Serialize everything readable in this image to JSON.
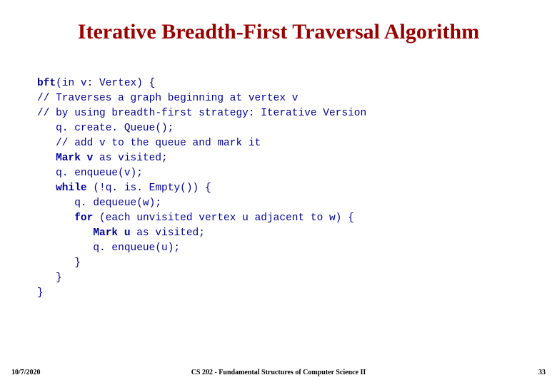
{
  "title": "Iterative Breadth-First Traversal Algorithm",
  "code": {
    "l1a": "bft",
    "l1b": "(in v: Vertex) {",
    "l2": "// Traverses a graph beginning at vertex v",
    "l3": "// by using breadth-first strategy: Iterative Version",
    "l4": "   q. create. Queue();",
    "l5": "   // add v to the queue and mark it",
    "l6a": "   Mark v",
    "l6b": " as visited;",
    "l7": "   q. enqueue(v);",
    "l8a": "   while",
    "l8b": " (!q. is. Empty()) {",
    "l9": "      q. dequeue(w);",
    "l10a": "      for",
    "l10b": " (each unvisited vertex u adjacent to w) {",
    "l11a": "         Mark u",
    "l11b": " as visited;",
    "l12": "         q. enqueue(u);",
    "l13": "      }",
    "l14": "   }",
    "l15": "}"
  },
  "footer": {
    "date": "10/7/2020",
    "center": "CS 202 - Fundamental Structures of Computer Science II",
    "page": "33"
  }
}
